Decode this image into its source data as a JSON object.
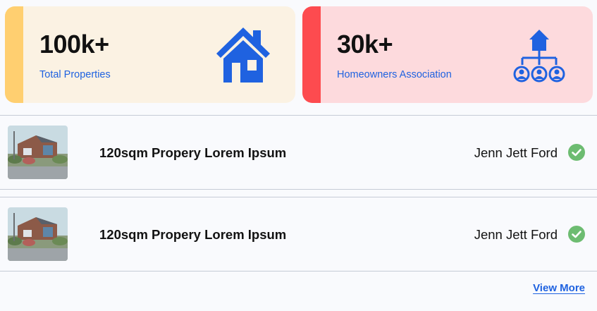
{
  "stats": [
    {
      "value": "100k+",
      "label": "Total Properties",
      "icon": "house-icon"
    },
    {
      "value": "30k+",
      "label": "Homeowners Association",
      "icon": "org-chart-people-icon"
    }
  ],
  "listings": [
    {
      "title": "120sqm Propery Lorem Ipsum",
      "owner": "Jenn Jett Ford",
      "status_icon": "check-circle-icon"
    },
    {
      "title": "120sqm Propery Lorem Ipsum",
      "owner": "Jenn Jett Ford",
      "status_icon": "check-circle-icon"
    }
  ],
  "view_more_label": "View More",
  "colors": {
    "accent_blue": "#1f62e0",
    "card_yellow_bg": "#fbf2e3",
    "card_yellow_stripe": "#ffcf70",
    "card_red_bg": "#fddadd",
    "card_red_stripe": "#fd4b4f",
    "check_green": "#6dbc71"
  }
}
